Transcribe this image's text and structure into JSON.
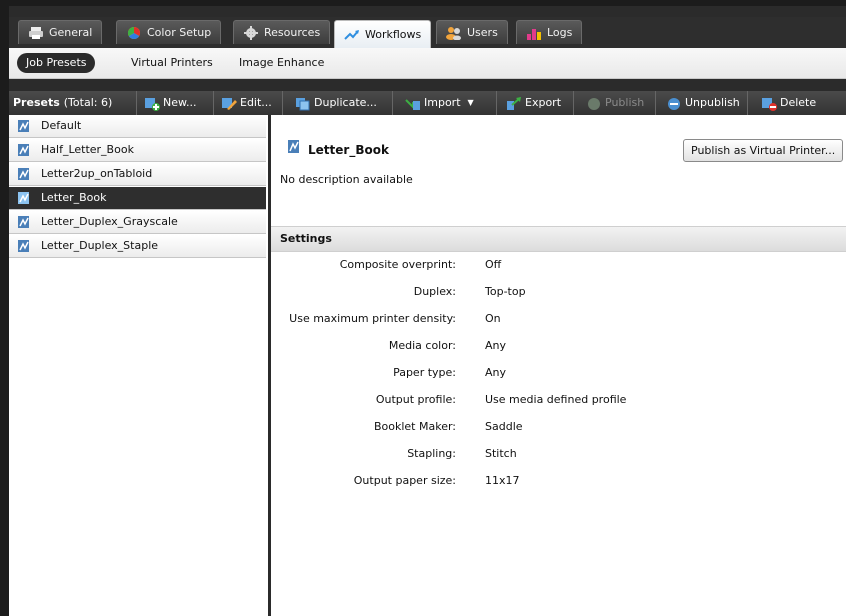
{
  "tabs": [
    {
      "label": "General",
      "icon": "printer-icon",
      "active": false
    },
    {
      "label": "Color Setup",
      "icon": "color-wheel-icon",
      "active": false
    },
    {
      "label": "Resources",
      "icon": "gear-icon",
      "active": false
    },
    {
      "label": "Workflows",
      "icon": "workflow-icon",
      "active": true
    },
    {
      "label": "Users",
      "icon": "users-icon",
      "active": false
    },
    {
      "label": "Logs",
      "icon": "bar-chart-icon",
      "active": false
    }
  ],
  "subtabs": [
    {
      "label": "Job Presets",
      "active": true
    },
    {
      "label": "Virtual Printers",
      "active": false
    },
    {
      "label": "Image Enhance",
      "active": false
    }
  ],
  "toolbar": {
    "title": "Presets",
    "count": "(Total: 6)",
    "buttons": [
      {
        "label": "New...",
        "icon": "new-preset-icon",
        "enabled": true
      },
      {
        "label": "Edit...",
        "icon": "edit-icon",
        "enabled": true
      },
      {
        "label": "Duplicate...",
        "icon": "duplicate-icon",
        "enabled": true
      },
      {
        "label": "Import",
        "icon": "import-icon",
        "enabled": true
      },
      {
        "label": "Export",
        "icon": "export-icon",
        "enabled": true
      },
      {
        "label": "Publish",
        "icon": "publish-icon",
        "enabled": false
      },
      {
        "label": "Unpublish",
        "icon": "unpublish-icon",
        "enabled": true
      },
      {
        "label": "Delete",
        "icon": "delete-icon",
        "enabled": true
      }
    ]
  },
  "presets": [
    {
      "label": "Default",
      "selected": false
    },
    {
      "label": "Half_Letter_Book",
      "selected": false
    },
    {
      "label": "Letter2up_onTabloid",
      "selected": false
    },
    {
      "label": "Letter_Book",
      "selected": true
    },
    {
      "label": "Letter_Duplex_Grayscale",
      "selected": false
    },
    {
      "label": "Letter_Duplex_Staple",
      "selected": false
    }
  ],
  "detail": {
    "name": "Letter_Book",
    "description": "No description available",
    "publish_button": "Publish as Virtual Printer...",
    "settings_title": "Settings",
    "settings": [
      {
        "label": "Composite overprint:",
        "value": "Off"
      },
      {
        "label": "Duplex:",
        "value": "Top-top"
      },
      {
        "label": "Use maximum printer density:",
        "value": "On"
      },
      {
        "label": "Media color:",
        "value": "Any"
      },
      {
        "label": "Paper type:",
        "value": "Any"
      },
      {
        "label": "Output profile:",
        "value": "Use media defined profile"
      },
      {
        "label": "Booklet Maker:",
        "value": "Saddle"
      },
      {
        "label": "Stapling:",
        "value": "Stitch"
      },
      {
        "label": "Output paper size:",
        "value": "11x17"
      }
    ]
  },
  "colors": {
    "accent": "#2e2e2e",
    "toolbar": "#3c3c3c",
    "panel": "#ffffff"
  }
}
